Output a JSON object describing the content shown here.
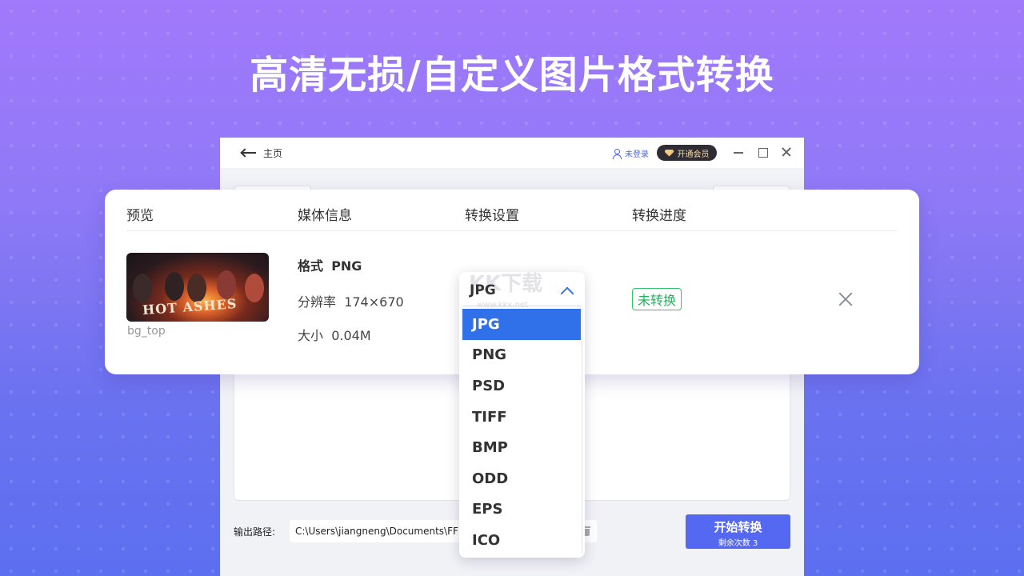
{
  "headline": "高清无损/自定义图片格式转换",
  "app": {
    "back_label": "主页",
    "login_label": "未登录",
    "vip_label": "开通会员",
    "output_label": "输出路径:",
    "output_path": "C:\\Users\\jiangneng\\Documents\\FFM",
    "start_button": {
      "label": "开始转换",
      "remaining": "剩余次数 3"
    }
  },
  "card": {
    "headers": [
      "预览",
      "媒体信息",
      "转换设置",
      "转换进度"
    ],
    "file": {
      "name": "bg_top",
      "thumbnail_text": "HOT ASHES",
      "format_label": "格式",
      "format_value": "PNG",
      "resolution_label": "分辨率",
      "resolution_value": "174×670",
      "size_label": "大小",
      "size_value": "0.04M"
    },
    "status": "未转换"
  },
  "dropdown": {
    "selected": "JPG",
    "watermark": "KK下载",
    "watermark_url": "www.kkx.net",
    "options": [
      "JPG",
      "PNG",
      "PSD",
      "TIFF",
      "BMP",
      "ODD",
      "EPS",
      "ICO"
    ],
    "active_index": 0,
    "active_color": "#3070e8"
  },
  "colors": {
    "accent": "#5568f2",
    "status_green": "#22b35a"
  }
}
